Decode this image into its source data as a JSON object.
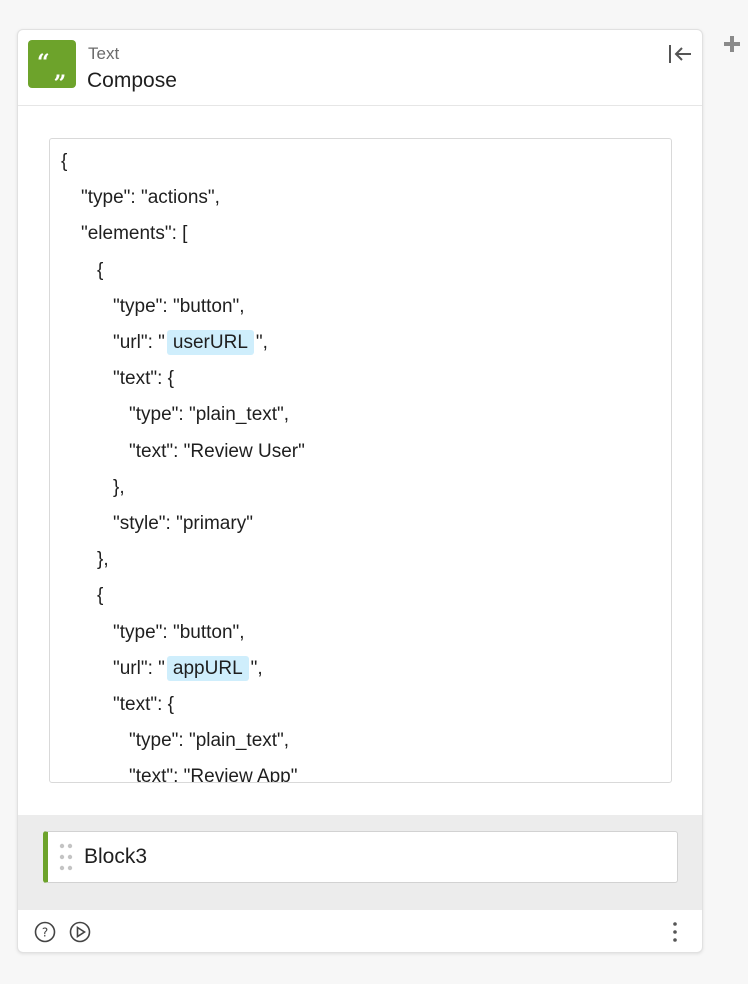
{
  "header": {
    "app_type": "Text",
    "action": "Compose"
  },
  "editor": {
    "lines": [
      {
        "indent": 0,
        "parts": [
          {
            "t": "text",
            "v": "{"
          }
        ]
      },
      {
        "indent": 1,
        "parts": [
          {
            "t": "text",
            "v": "\"type\": \"actions\","
          }
        ]
      },
      {
        "indent": 1,
        "parts": [
          {
            "t": "text",
            "v": "\"elements\": ["
          }
        ]
      },
      {
        "indent": 2,
        "parts": [
          {
            "t": "text",
            "v": "{"
          }
        ]
      },
      {
        "indent": 3,
        "parts": [
          {
            "t": "text",
            "v": "\"type\": \"button\","
          }
        ]
      },
      {
        "indent": 3,
        "parts": [
          {
            "t": "text",
            "v": "\"url\": \""
          },
          {
            "t": "pill",
            "v": "userURL"
          },
          {
            "t": "text",
            "v": "\","
          }
        ]
      },
      {
        "indent": 3,
        "parts": [
          {
            "t": "text",
            "v": "\"text\": {"
          }
        ]
      },
      {
        "indent": 4,
        "parts": [
          {
            "t": "text",
            "v": "\"type\": \"plain_text\","
          }
        ]
      },
      {
        "indent": 4,
        "parts": [
          {
            "t": "text",
            "v": "\"text\": \"Review User\""
          }
        ]
      },
      {
        "indent": 3,
        "parts": [
          {
            "t": "text",
            "v": "},"
          }
        ]
      },
      {
        "indent": 3,
        "parts": [
          {
            "t": "text",
            "v": "\"style\": \"primary\""
          }
        ]
      },
      {
        "indent": 2,
        "parts": [
          {
            "t": "text",
            "v": "},"
          }
        ]
      },
      {
        "indent": 2,
        "parts": [
          {
            "t": "text",
            "v": "{"
          }
        ]
      },
      {
        "indent": 3,
        "parts": [
          {
            "t": "text",
            "v": "\"type\": \"button\","
          }
        ]
      },
      {
        "indent": 3,
        "parts": [
          {
            "t": "text",
            "v": "\"url\": \""
          },
          {
            "t": "pill",
            "v": "appURL"
          },
          {
            "t": "text",
            "v": "\","
          }
        ]
      },
      {
        "indent": 3,
        "parts": [
          {
            "t": "text",
            "v": "\"text\": {"
          }
        ]
      },
      {
        "indent": 4,
        "parts": [
          {
            "t": "text",
            "v": "\"type\": \"plain_text\","
          }
        ]
      },
      {
        "indent": 4,
        "parts": [
          {
            "t": "text",
            "v": "\"text\": \"Review App\""
          }
        ]
      }
    ]
  },
  "block": {
    "label": "Block3"
  },
  "colors": {
    "accent": "#6da32b",
    "pill_bg": "#cfeefc"
  },
  "icons": {
    "app": "quote-icon",
    "collapse": "collapse-left-icon",
    "add": "plus-icon",
    "drag": "drag-handle-icon",
    "help": "help-circle-icon",
    "play": "play-circle-icon",
    "more": "more-vertical-icon"
  }
}
